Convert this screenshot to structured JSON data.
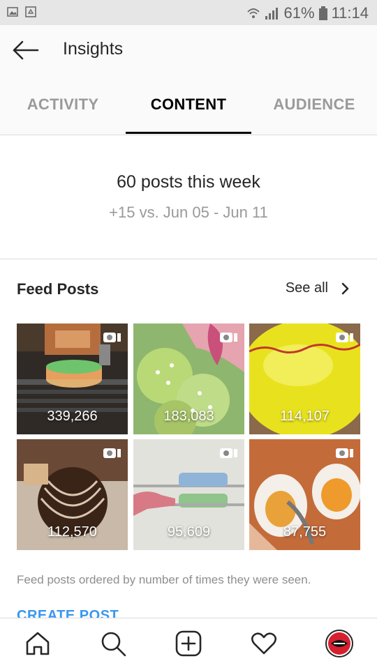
{
  "status_bar": {
    "battery_percent": "61%",
    "time": "11:14"
  },
  "header": {
    "title": "Insights"
  },
  "tabs": [
    {
      "label": "ACTIVITY",
      "active": false
    },
    {
      "label": "CONTENT",
      "active": true
    },
    {
      "label": "AUDIENCE",
      "active": false
    }
  ],
  "summary": {
    "headline": "60 posts this week",
    "comparison": "+15 vs. Jun 05 - Jun 11"
  },
  "feed_posts": {
    "title": "Feed Posts",
    "see_all_label": "See all",
    "posts": [
      {
        "views": "339,266",
        "media": "video"
      },
      {
        "views": "183,083",
        "media": "video"
      },
      {
        "views": "114,107",
        "media": "video"
      },
      {
        "views": "112,570",
        "media": "video"
      },
      {
        "views": "95,609",
        "media": "video"
      },
      {
        "views": "87,755",
        "media": "video"
      }
    ],
    "caption": "Feed posts ordered by number of times they were seen.",
    "create_post_label": "CREATE POST"
  },
  "bottom_nav": [
    "home-icon",
    "search-icon",
    "add-post-icon",
    "heart-icon",
    "profile-avatar"
  ],
  "colors": {
    "accent": "#3897f0",
    "active_tab": "#000000",
    "inactive_tab": "#9a9a9a"
  }
}
